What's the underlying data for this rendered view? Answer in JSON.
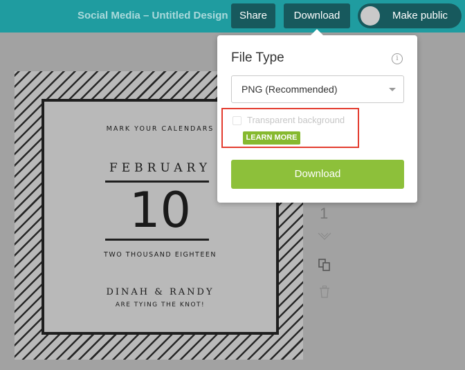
{
  "header": {
    "title": "Social Media – Untitled Design",
    "share_label": "Share",
    "download_label": "Download",
    "public_label": "Make public"
  },
  "design": {
    "mark_calendars": "MARK YOUR CALENDARS",
    "month": "FEBRUARY",
    "day": "10",
    "year": "TWO THOUSAND EIGHTEEN",
    "names": "DINAH & RANDY",
    "tying": "ARE TYING THE KNOT!"
  },
  "side_tools": {
    "page_number": "1",
    "icons": [
      "chevron-down-icon",
      "copy-icon",
      "trash-icon"
    ]
  },
  "download_panel": {
    "file_type_label": "File Type",
    "file_type_selected": "PNG (Recommended)",
    "transparent_label": "Transparent background",
    "learn_more_label": "LEARN MORE",
    "download_label": "Download"
  },
  "colors": {
    "topbar": "#1f9ca0",
    "topbar_button": "#17595d",
    "accent_green": "#8dc03a",
    "highlight_red": "#e33b2e"
  }
}
